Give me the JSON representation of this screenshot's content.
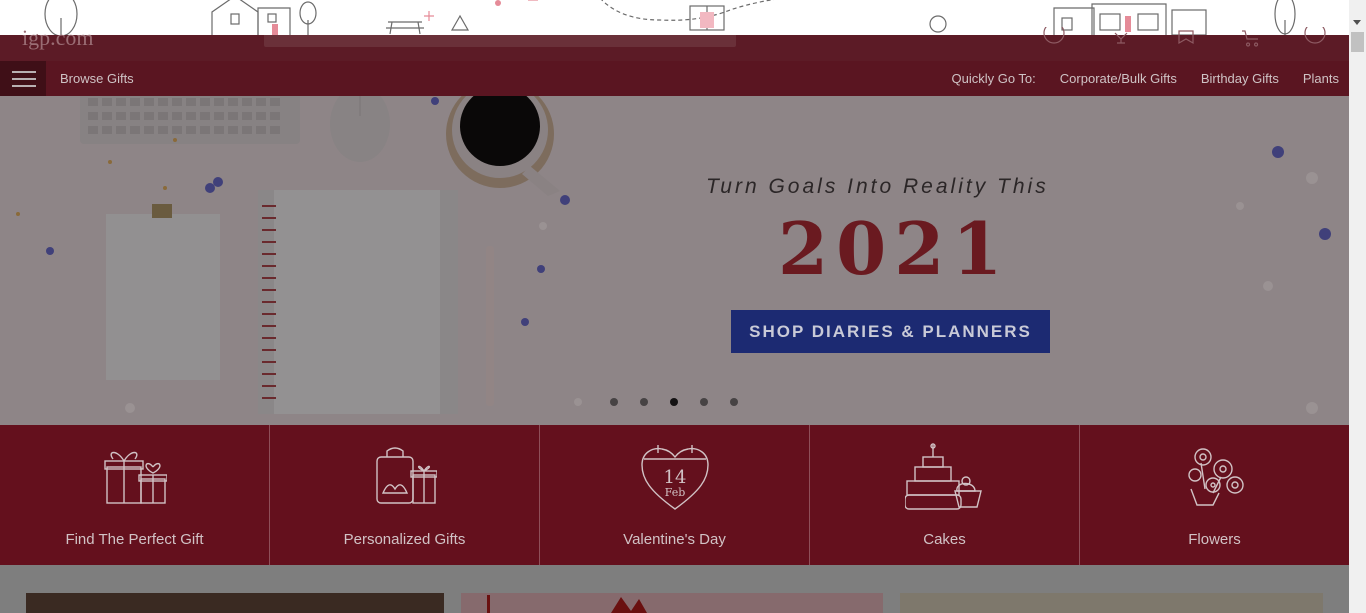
{
  "header": {
    "logo_text": "igp.com",
    "nav": {
      "browse_label": "Browse Gifts",
      "quick_label": "Quickly Go To:",
      "quick_links": [
        "Corporate/Bulk Gifts",
        "Birthday Gifts",
        "Plants"
      ]
    }
  },
  "hero": {
    "tagline": "Turn Goals Into Reality This",
    "year": "2021",
    "cta_label": "SHOP DIARIES & PLANNERS",
    "slides_total": 5,
    "active_slide": 3
  },
  "categories": [
    {
      "label": "Find The Perfect Gift",
      "icon": "gift-boxes-icon"
    },
    {
      "label": "Personalized Gifts",
      "icon": "personalized-bag-icon"
    },
    {
      "label": "Valentine's Day",
      "icon": "calendar-heart-icon",
      "day": "14",
      "month": "Feb"
    },
    {
      "label": "Cakes",
      "icon": "cake-icon"
    },
    {
      "label": "Flowers",
      "icon": "flower-bouquet-icon"
    }
  ],
  "colors": {
    "accent_red": "#64101d",
    "nav_red": "#5a1521",
    "cta_blue": "#1c2a72"
  }
}
